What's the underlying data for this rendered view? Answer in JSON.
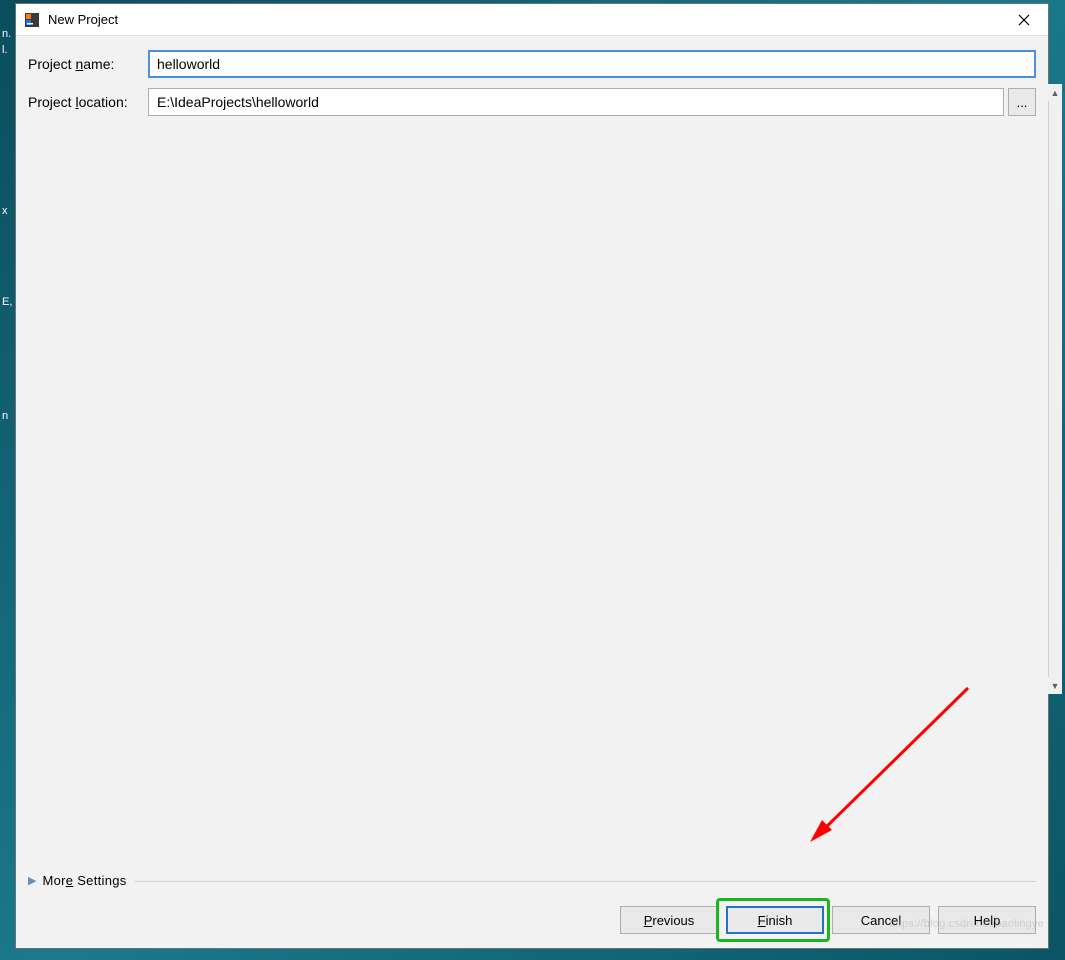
{
  "desktop": {
    "fragments": [
      "n.",
      "l.",
      "x",
      "E,",
      "n"
    ]
  },
  "dialog": {
    "title": "New Project",
    "close_tooltip": "Close",
    "fields": {
      "project_name": {
        "label_pre": "Project ",
        "label_u": "n",
        "label_post": "ame:",
        "value": "helloworld"
      },
      "project_location": {
        "label_pre": "Project ",
        "label_u": "l",
        "label_post": "ocation:",
        "value": "E:\\IdeaProjects\\helloworld",
        "browse_label": "..."
      }
    },
    "more_settings": {
      "label_pre": "Mor",
      "label_u": "e",
      "label_post": " Settings"
    },
    "buttons": {
      "previous": {
        "u": "P",
        "rest": "revious"
      },
      "finish": {
        "u": "F",
        "rest": "inish"
      },
      "cancel": {
        "text": "Cancel"
      },
      "help": {
        "text": "Help"
      }
    }
  },
  "watermark": "https://blog.csdn.net/baolingye"
}
